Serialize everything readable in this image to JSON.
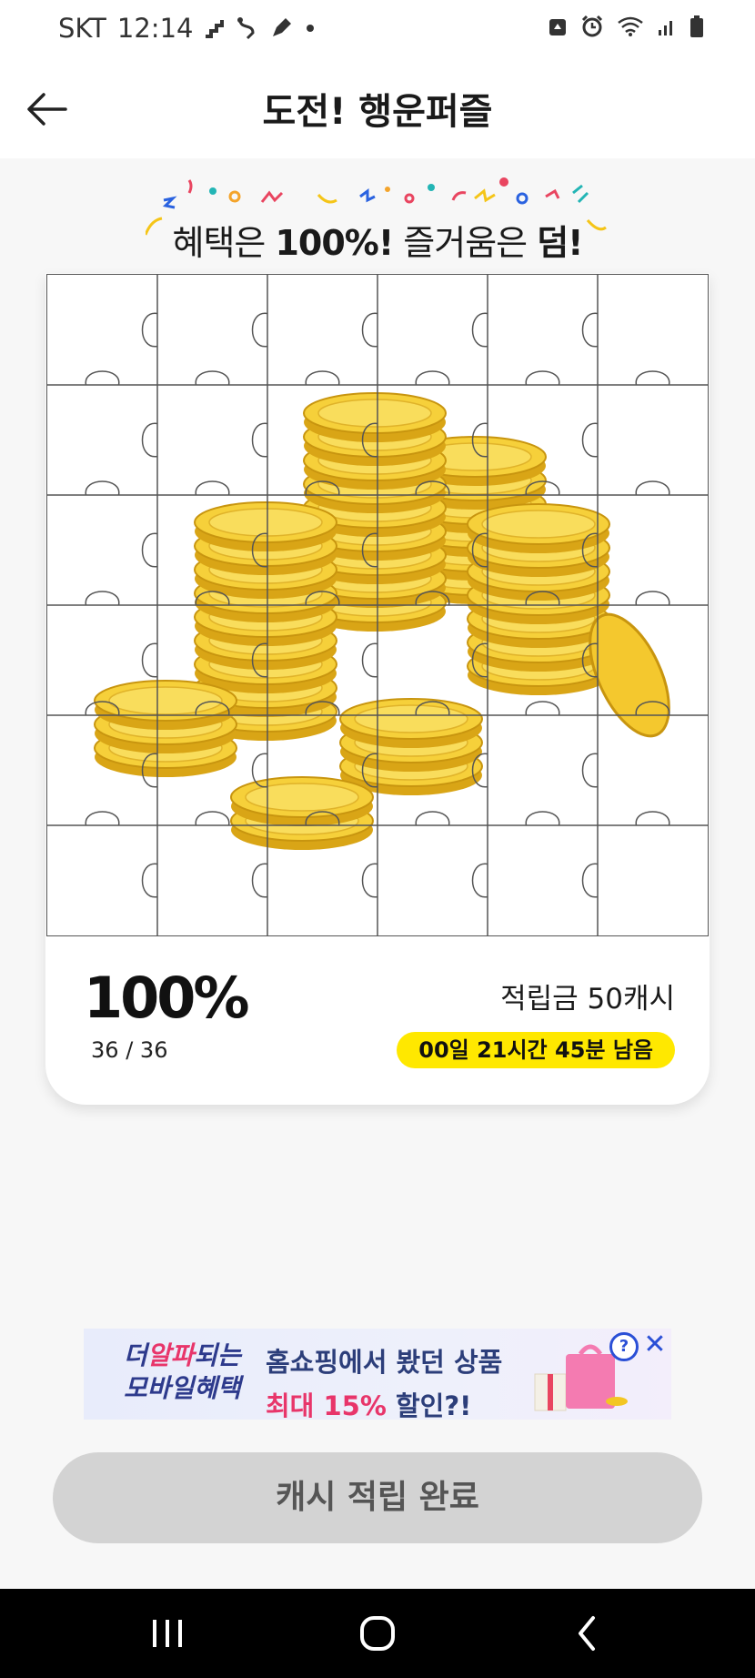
{
  "status_bar": {
    "carrier": "SKT",
    "time": "12:14",
    "left_icons": [
      "stairs-icon",
      "route-icon",
      "pen-icon",
      "dot-icon"
    ],
    "right_icons": [
      "recycle-icon",
      "alarm-icon",
      "wifi-icon",
      "signal-icon",
      "battery-icon"
    ]
  },
  "app_bar": {
    "back_icon": "back-arrow-icon",
    "title": "도전! 행운퍼즐"
  },
  "headline": {
    "part1": "혜택은 ",
    "part2": "100%!",
    "part3": " 즐거움은 ",
    "part4": "덤!"
  },
  "puzzle": {
    "rows": 6,
    "cols": 6,
    "image": "gold-coin-stacks",
    "progress_percent": "100%",
    "pieces_done": "36",
    "pieces_total": "36",
    "count_sep": "/"
  },
  "reward": {
    "label": "적립금 50캐시",
    "timer": "00일 21시간 45분 남음"
  },
  "ad": {
    "brand_line1_a": "더",
    "brand_line1_b": "알파",
    "brand_line1_c": "되는",
    "brand_line2": "모바일혜택",
    "line1": "홈쇼핑에서 봤던 상품",
    "line2_a": "최대 15%",
    "line2_b": " 할인?!",
    "help_label": "?",
    "close_label": "✕"
  },
  "complete_button": {
    "label": "캐시 적립 완료"
  },
  "nav_bar": {
    "icons": [
      "recents-icon",
      "home-icon",
      "back-icon"
    ]
  },
  "colors": {
    "timer_bg": "#ffe800",
    "button_bg": "#d3d3d3",
    "coin_gold": "#f3c623",
    "ad_accent": "#2a4fd6",
    "ad_pink": "#e8356a"
  }
}
